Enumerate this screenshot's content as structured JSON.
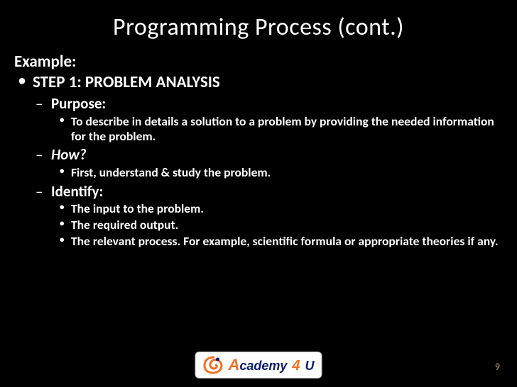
{
  "slide": {
    "title": "Programming Process (cont.)",
    "lead": "Example:",
    "step1": {
      "label": "STEP 1: PROBLEM ANALYSIS",
      "purpose": {
        "label": "Purpose:",
        "items": [
          "To describe in details a solution to a problem by providing the needed information for the problem."
        ]
      },
      "how": {
        "label": "How?",
        "items": [
          "First, understand & study the problem."
        ]
      },
      "identify": {
        "label": "Identify:",
        "items": [
          "The input to the problem.",
          "The required output.",
          "The relevant process. For example, scientific formula or appropriate theories if any."
        ]
      }
    }
  },
  "logo": {
    "brand_a": "A",
    "brand_rest": "cademy",
    "brand_four": "4",
    "brand_u": "U"
  },
  "page_number": "9"
}
